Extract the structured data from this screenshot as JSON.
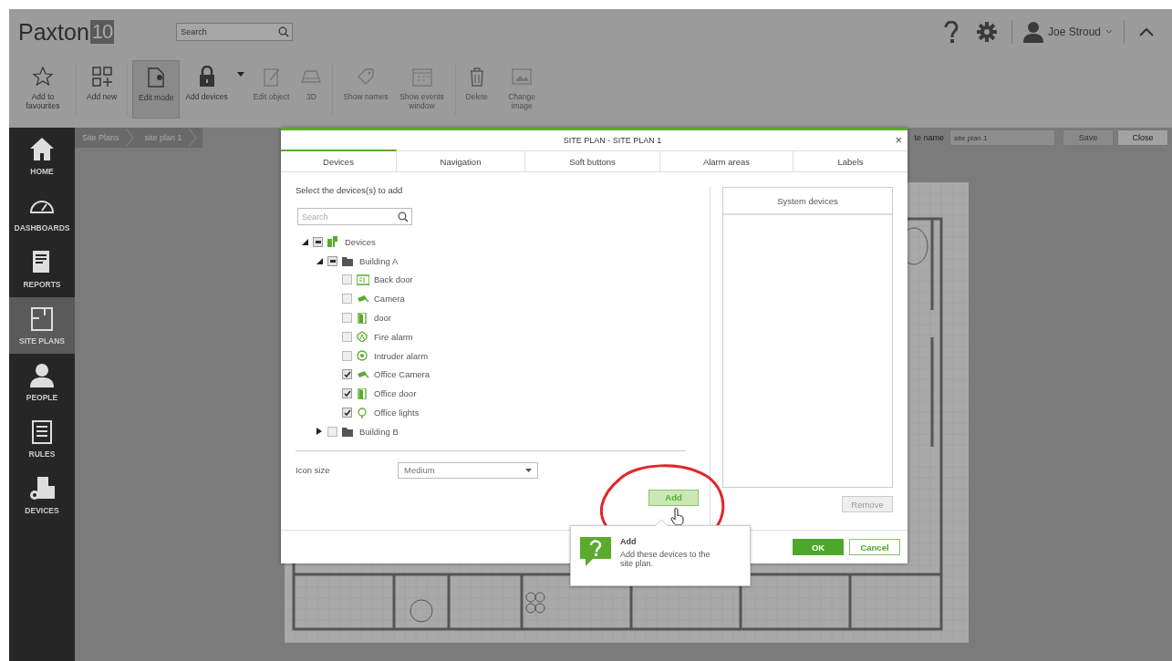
{
  "header": {
    "logo": {
      "text": "Paxton",
      "badge": "10"
    },
    "search": {
      "placeholder": "Search"
    },
    "user": "Joe Stroud"
  },
  "toolbar": [
    {
      "label": "Add to favourites",
      "selected": false,
      "disabled": false
    },
    {
      "label": "Add new",
      "selected": false,
      "disabled": false
    },
    {
      "label": "Edit mode",
      "selected": true,
      "disabled": false
    },
    {
      "label": "Add devices",
      "selected": false,
      "disabled": false,
      "menu": true
    },
    {
      "label": "Edit object",
      "selected": false,
      "disabled": true
    },
    {
      "label": "3D",
      "selected": false,
      "disabled": true
    },
    {
      "label": "Show names",
      "selected": false,
      "disabled": true
    },
    {
      "label": "Show events window",
      "selected": false,
      "disabled": true
    },
    {
      "label": "Delete",
      "selected": false,
      "disabled": true
    },
    {
      "label": "Change image",
      "selected": false,
      "disabled": true
    }
  ],
  "sidebar": {
    "items": [
      {
        "label": "HOME",
        "selected": false
      },
      {
        "label": "DASHBOARDS",
        "selected": false
      },
      {
        "label": "REPORTS",
        "selected": false
      },
      {
        "label": "SITE PLANS",
        "selected": true
      },
      {
        "label": "PEOPLE",
        "selected": false
      },
      {
        "label": "RULES",
        "selected": false
      },
      {
        "label": "DEVICES",
        "selected": false
      }
    ]
  },
  "breadcrumb": [
    "Site Plans",
    "site plan 1"
  ],
  "site_name": {
    "label": "te name",
    "value": "site plan 1",
    "buttons": [
      {
        "label": "Save",
        "disabled": true
      },
      {
        "label": "Close",
        "disabled": false
      }
    ]
  },
  "dialog": {
    "title": "SITE PLAN - SITE PLAN 1",
    "close": "×",
    "tabs": [
      {
        "label": "Devices",
        "selected": true
      },
      {
        "label": "Navigation",
        "selected": false
      },
      {
        "label": "Soft buttons",
        "selected": false
      },
      {
        "label": "Alarm areas",
        "selected": false
      },
      {
        "label": "Labels",
        "selected": false
      }
    ],
    "prompt": "Select the devices(s) to add",
    "search": {
      "placeholder": "Search"
    },
    "tree": [
      {
        "label": "Devices",
        "kind": "site",
        "expanded": true,
        "mixed": true,
        "children": [
          {
            "label": "Building A",
            "kind": "folder",
            "expanded": true,
            "mixed": true,
            "children": [
              {
                "label": "Back door",
                "kind": "reader",
                "checked": false
              },
              {
                "label": "Camera",
                "kind": "camera",
                "checked": false
              },
              {
                "label": "door",
                "kind": "door",
                "checked": false
              },
              {
                "label": "Fire alarm",
                "kind": "fire",
                "checked": false
              },
              {
                "label": "Intruder alarm",
                "kind": "intruder",
                "checked": false
              },
              {
                "label": "Office Camera",
                "kind": "camera",
                "checked": true
              },
              {
                "label": "Office door",
                "kind": "door",
                "checked": true
              },
              {
                "label": "Office lights",
                "kind": "light",
                "checked": true
              }
            ]
          },
          {
            "label": "Building B",
            "kind": "folder",
            "expanded": false,
            "checked": false,
            "mixed": false
          }
        ]
      }
    ],
    "icon_size": {
      "label": "Icon size",
      "value": "Medium"
    },
    "add_button": {
      "label": "Add",
      "hover": true
    },
    "system_devices": {
      "title": "System devices"
    },
    "remove_button": {
      "label": "Remove",
      "disabled": true
    },
    "ok": "OK",
    "cancel": "Cancel"
  },
  "tooltip": {
    "title": "Add",
    "text": "Add these devices to the site plan."
  }
}
